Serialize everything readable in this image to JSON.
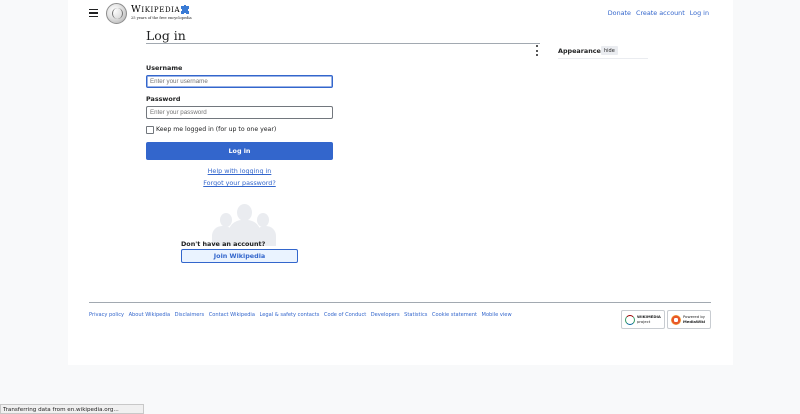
{
  "header": {
    "wordmark": "Wikipedia",
    "tagline": "25 years of the free encyclopedia",
    "links": [
      "Donate",
      "Create account",
      "Log in"
    ]
  },
  "heading": "Log in",
  "appearance": {
    "title": "Appearance",
    "hide_label": "hide"
  },
  "form": {
    "username_label": "Username",
    "username_placeholder": "Enter your username",
    "password_label": "Password",
    "password_placeholder": "Enter your password",
    "remember_label": "Keep me logged in (for up to one year)",
    "login_button": "Log in",
    "help_link": "Help with logging in",
    "forgot_link": "Forgot your password?"
  },
  "create_account": {
    "prompt": "Don't have an account?",
    "join_button": "Join Wikipedia"
  },
  "footer": {
    "links": [
      "Privacy policy",
      "About Wikipedia",
      "Disclaimers",
      "Contact Wikipedia",
      "Legal & safety contacts",
      "Code of Conduct",
      "Developers",
      "Statistics",
      "Cookie statement",
      "Mobile view"
    ],
    "wikimedia_badge": [
      "WIKIMEDIA",
      "project"
    ],
    "mediawiki_badge": [
      "Powered by",
      "MediaWiki"
    ]
  },
  "statusbar": "Transferring data from en.wikipedia.org...",
  "colors": {
    "link": "#3366cc",
    "primary_button": "#3366cc",
    "border": "#a2a9b1"
  }
}
